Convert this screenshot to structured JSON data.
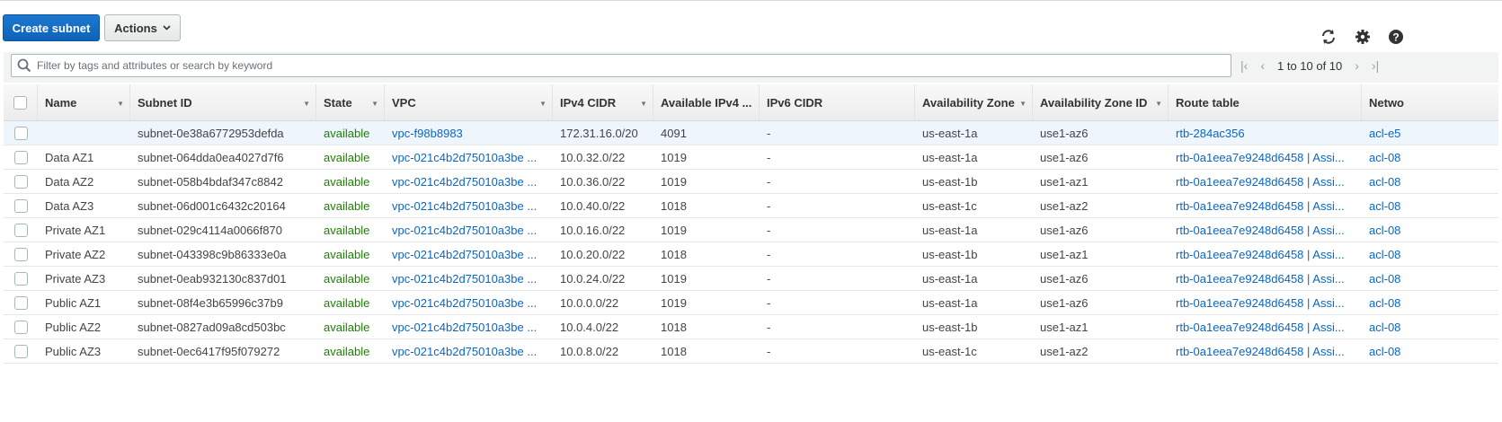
{
  "toolbar": {
    "create_label": "Create subnet",
    "actions_label": "Actions"
  },
  "search": {
    "placeholder": "Filter by tags and attributes or search by keyword"
  },
  "pagination": {
    "text": "1 to 10 of 10"
  },
  "columns": [
    "Name",
    "Subnet ID",
    "State",
    "VPC",
    "IPv4 CIDR",
    "Available IPv4 ...",
    "IPv6 CIDR",
    "Availability Zone",
    "Availability Zone ID",
    "Route table",
    "Netwo"
  ],
  "rows": [
    {
      "name": "",
      "subnet_id": "subnet-0e38a6772953defda",
      "state": "available",
      "vpc": "vpc-f98b8983",
      "ipv4": "172.31.16.0/20",
      "avail": "4091",
      "ipv6": "-",
      "az": "us-east-1a",
      "azid": "use1-az6",
      "rtb": "rtb-284ac356",
      "acl": "acl-e5"
    },
    {
      "name": "Data AZ1",
      "subnet_id": "subnet-064dda0ea4027d7f6",
      "state": "available",
      "vpc": "vpc-021c4b2d75010a3be ...",
      "ipv4": "10.0.32.0/22",
      "avail": "1019",
      "ipv6": "-",
      "az": "us-east-1a",
      "azid": "use1-az6",
      "rtb": "rtb-0a1eea7e9248d6458 | Assi...",
      "acl": "acl-08"
    },
    {
      "name": "Data AZ2",
      "subnet_id": "subnet-058b4bdaf347c8842",
      "state": "available",
      "vpc": "vpc-021c4b2d75010a3be ...",
      "ipv4": "10.0.36.0/22",
      "avail": "1019",
      "ipv6": "-",
      "az": "us-east-1b",
      "azid": "use1-az1",
      "rtb": "rtb-0a1eea7e9248d6458 | Assi...",
      "acl": "acl-08"
    },
    {
      "name": "Data AZ3",
      "subnet_id": "subnet-06d001c6432c20164",
      "state": "available",
      "vpc": "vpc-021c4b2d75010a3be ...",
      "ipv4": "10.0.40.0/22",
      "avail": "1018",
      "ipv6": "-",
      "az": "us-east-1c",
      "azid": "use1-az2",
      "rtb": "rtb-0a1eea7e9248d6458 | Assi...",
      "acl": "acl-08"
    },
    {
      "name": "Private AZ1",
      "subnet_id": "subnet-029c4114a0066f870",
      "state": "available",
      "vpc": "vpc-021c4b2d75010a3be ...",
      "ipv4": "10.0.16.0/22",
      "avail": "1019",
      "ipv6": "-",
      "az": "us-east-1a",
      "azid": "use1-az6",
      "rtb": "rtb-0a1eea7e9248d6458 | Assi...",
      "acl": "acl-08"
    },
    {
      "name": "Private AZ2",
      "subnet_id": "subnet-043398c9b86333e0a",
      "state": "available",
      "vpc": "vpc-021c4b2d75010a3be ...",
      "ipv4": "10.0.20.0/22",
      "avail": "1018",
      "ipv6": "-",
      "az": "us-east-1b",
      "azid": "use1-az1",
      "rtb": "rtb-0a1eea7e9248d6458 | Assi...",
      "acl": "acl-08"
    },
    {
      "name": "Private AZ3",
      "subnet_id": "subnet-0eab932130c837d01",
      "state": "available",
      "vpc": "vpc-021c4b2d75010a3be ...",
      "ipv4": "10.0.24.0/22",
      "avail": "1019",
      "ipv6": "-",
      "az": "us-east-1a",
      "azid": "use1-az6",
      "rtb": "rtb-0a1eea7e9248d6458 | Assi...",
      "acl": "acl-08"
    },
    {
      "name": "Public AZ1",
      "subnet_id": "subnet-08f4e3b65996c37b9",
      "state": "available",
      "vpc": "vpc-021c4b2d75010a3be ...",
      "ipv4": "10.0.0.0/22",
      "avail": "1019",
      "ipv6": "-",
      "az": "us-east-1a",
      "azid": "use1-az6",
      "rtb": "rtb-0a1eea7e9248d6458 | Assi...",
      "acl": "acl-08"
    },
    {
      "name": "Public AZ2",
      "subnet_id": "subnet-0827ad09a8cd503bc",
      "state": "available",
      "vpc": "vpc-021c4b2d75010a3be ...",
      "ipv4": "10.0.4.0/22",
      "avail": "1018",
      "ipv6": "-",
      "az": "us-east-1b",
      "azid": "use1-az1",
      "rtb": "rtb-0a1eea7e9248d6458 | Assi...",
      "acl": "acl-08"
    },
    {
      "name": "Public AZ3",
      "subnet_id": "subnet-0ec6417f95f079272",
      "state": "available",
      "vpc": "vpc-021c4b2d75010a3be ...",
      "ipv4": "10.0.8.0/22",
      "avail": "1018",
      "ipv6": "-",
      "az": "us-east-1c",
      "azid": "use1-az2",
      "rtb": "rtb-0a1eea7e9248d6458 | Assi...",
      "acl": "acl-08"
    }
  ],
  "colors": {
    "primary": "#0d63b8",
    "link": "#0b66c2",
    "available": "#1d8102",
    "selected_row": "#eef5fc"
  }
}
